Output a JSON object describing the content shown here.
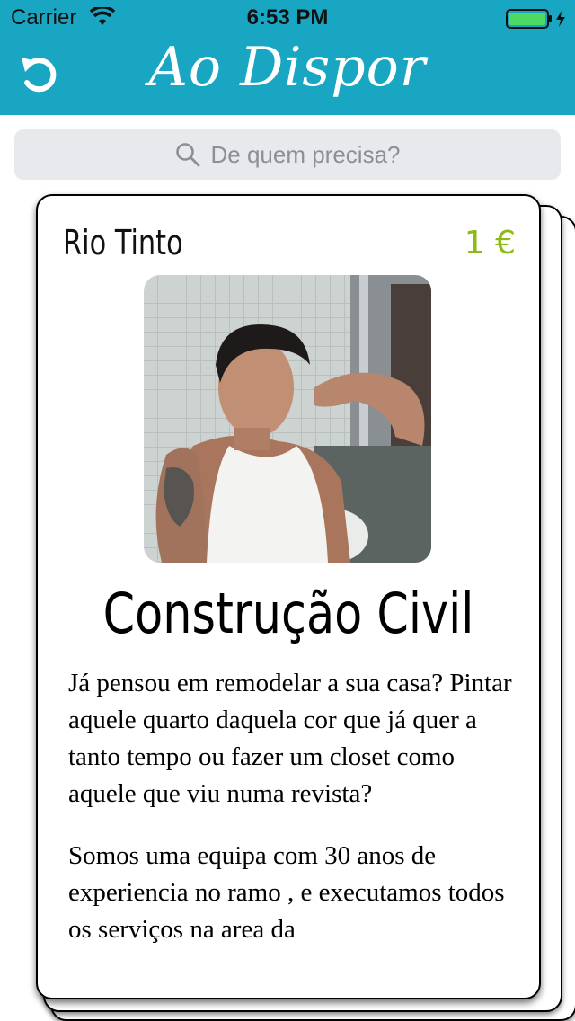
{
  "status_bar": {
    "carrier": "Carrier",
    "time": "6:53 PM"
  },
  "nav": {
    "title": "Ao Dispor",
    "refresh_icon": "refresh-icon"
  },
  "search": {
    "placeholder": "De quem precisa?",
    "icon": "search-icon"
  },
  "card": {
    "location": "Rio Tinto",
    "price": "1 €",
    "title": "Construção Civil",
    "description": [
      "Já pensou em remodelar a sua casa? Pintar aquele quarto daquela cor que já quer a tanto tempo ou fazer um closet como aquele que viu numa revista?",
      "Somos uma equipa com 30 anos de experiencia no ramo , e executamos todos os serviços na area da"
    ]
  },
  "colors": {
    "nav_background": "#18a6c3",
    "price": "#8dbb15",
    "search_background": "#e8e9ec"
  }
}
